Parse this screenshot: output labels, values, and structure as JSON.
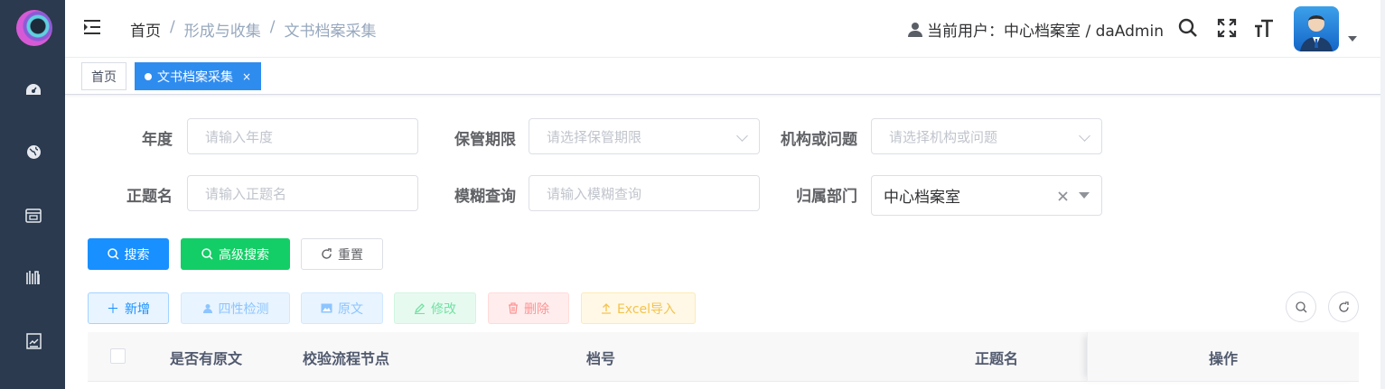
{
  "sidebar": {
    "icons": [
      "dashboard-icon",
      "globe-icon",
      "archive-box-icon",
      "bookshelf-icon",
      "report-icon"
    ]
  },
  "header": {
    "breadcrumb": [
      "首页",
      "形成与收集",
      "文书档案采集"
    ],
    "separator": "/",
    "user_label": "当前用户：中心档案室 / daAdmin"
  },
  "tabs": [
    {
      "label": "首页",
      "active": false
    },
    {
      "label": "文书档案采集",
      "active": true,
      "close": "×"
    }
  ],
  "search_form": {
    "year": {
      "label": "年度",
      "placeholder": "请输入年度"
    },
    "retention": {
      "label": "保管期限",
      "placeholder": "请选择保管期限"
    },
    "org": {
      "label": "机构或问题",
      "placeholder": "请选择机构或问题"
    },
    "title": {
      "label": "正题名",
      "placeholder": "请输入正题名"
    },
    "fuzzy": {
      "label": "模糊查询",
      "placeholder": "请输入模糊查询"
    },
    "dept": {
      "label": "归属部门",
      "value": "中心档案室"
    }
  },
  "search_buttons": {
    "search": "搜索",
    "advanced": "高级搜索",
    "reset": "重置"
  },
  "toolbar": {
    "add": "新增",
    "check": "四性检测",
    "original": "原文",
    "edit": "修改",
    "delete": "删除",
    "import": "Excel导入"
  },
  "table": {
    "columns": [
      "是否有原文",
      "校验流程节点",
      "档号",
      "正题名",
      "操作"
    ]
  },
  "colors": {
    "primary": "#1890ff",
    "success": "#13ce66",
    "sidebar": "#2b3a4e"
  }
}
